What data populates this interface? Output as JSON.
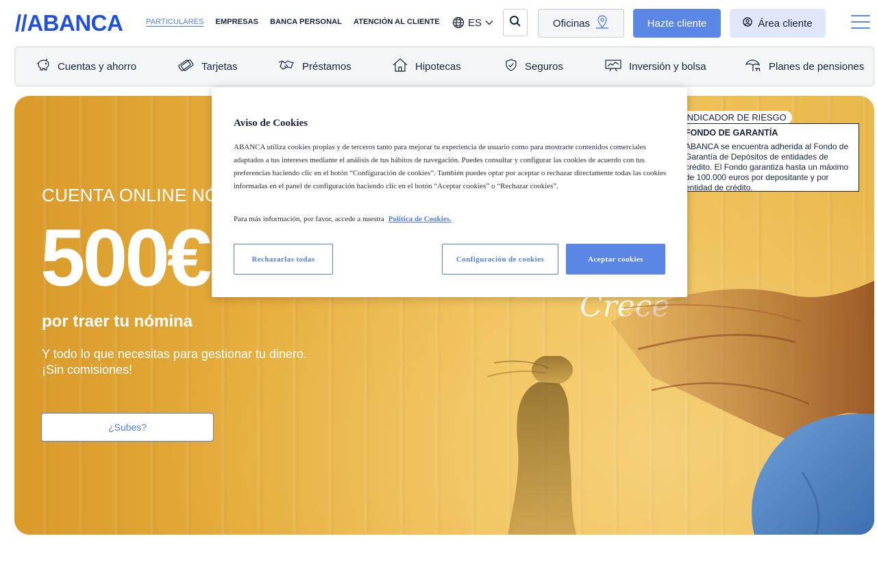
{
  "header": {
    "logo": "//ABANCA",
    "nav": [
      "PARTICULARES",
      "EMPRESAS",
      "BANCA PERSONAL",
      "ATENCIÓN AL CLIENTE"
    ],
    "language": "ES",
    "oficinas_label": "Oficinas",
    "hazte_label": "Hazte cliente",
    "area_label": "Área cliente",
    "icons": [
      "globe-icon",
      "chevron-down-icon",
      "search-icon",
      "location-pin-icon",
      "user-icon",
      "menu-icon"
    ]
  },
  "products": [
    {
      "label": "Cuentas y ahorro",
      "icon": "piggy-bank-icon"
    },
    {
      "label": "Tarjetas",
      "icon": "cards-icon"
    },
    {
      "label": "Préstamos",
      "icon": "handshake-icon"
    },
    {
      "label": "Hipotecas",
      "icon": "house-icon"
    },
    {
      "label": "Seguros",
      "icon": "shield-icon"
    },
    {
      "label": "Inversión y bolsa",
      "icon": "chart-board-icon"
    },
    {
      "label": "Planes de pensiones",
      "icon": "beach-umbrella-icon"
    }
  ],
  "hero": {
    "kicker": "CUENTA ONLINE NÓMINA",
    "amount": "500€",
    "subtitle": "por traer tu nómina",
    "description_line1": "Y todo lo que necesitas para gestionar tu dinero.",
    "description_line2": "¡Sin comisiones!",
    "cta": "¿Subes?",
    "overlay_word": "Crece",
    "risk_tag": "INDICADOR DE RIESGO",
    "risk_title": "FONDO DE GARANTÍA",
    "risk_text": "ABANCA se encuentra adherida al Fondo de Garantía de Depósitos de entidades de crédito. El Fondo garantiza hasta un máximo de 100.000 euros por depositante y por entidad de crédito."
  },
  "cookies": {
    "title": "Aviso de Cookies",
    "body": "ABANCA utiliza cookies propias y de terceros tanto para mejorar tu experiencia de usuario como para mostrarte contenidos comerciales adaptados a tus intereses mediante el análisis de tus hábitos de navegación. Puedes consultar y configurar las cookies de acuerdo con tus preferencias haciendo clic en el botón “Configuración de cookies”. También puedes optar por aceptar o rechazar directamente todas las cookies informadas en el panel de configuración haciendo clic en el botón “Aceptar cookies” o “Rechazar cookies”.",
    "more_text": "Para más información, por favor, accede a nuestra",
    "policy_link": "Política de Cookies.",
    "reject_label": "Rechazarlas todas",
    "config_label": "Configuración de cookies",
    "accept_label": "Aceptar cookies"
  },
  "colors": {
    "brand_blue": "#2350d8",
    "accent_blue": "#5a87e6",
    "hero_yellow": "#e6ae3c"
  }
}
